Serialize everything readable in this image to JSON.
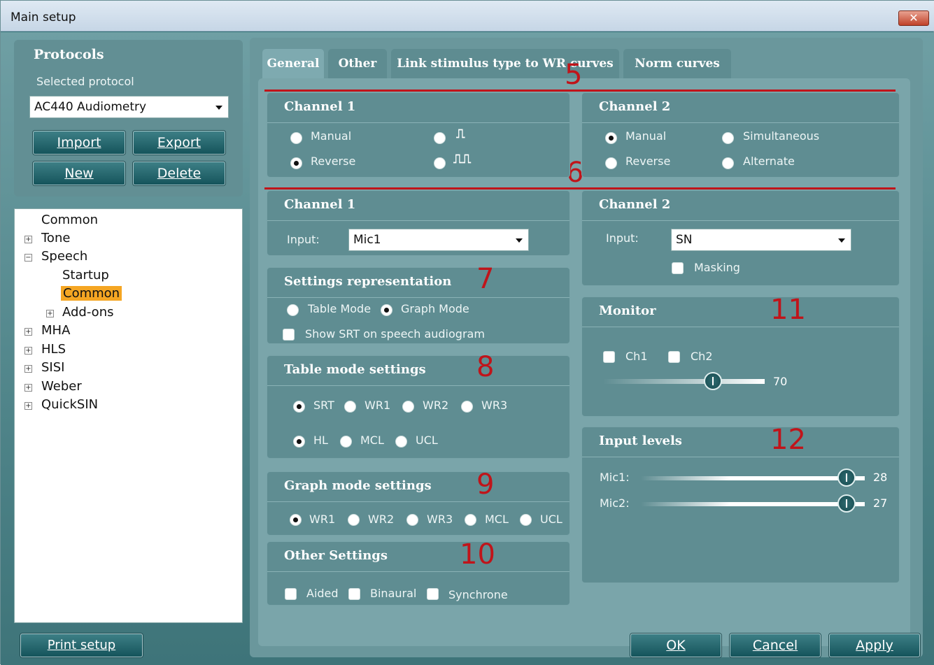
{
  "window": {
    "title": "Main setup",
    "close_glyph": "✕"
  },
  "protocols": {
    "heading": "Protocols",
    "selected_label": "Selected protocol",
    "selected_value": "AC440 Audiometry",
    "buttons": {
      "import": "Import",
      "export": "Export",
      "new": "New",
      "delete": "Delete"
    }
  },
  "tree": {
    "items": [
      {
        "label": "Common"
      },
      {
        "label": "Tone"
      },
      {
        "label": "Speech"
      },
      {
        "label": "Startup"
      },
      {
        "label": "Common"
      },
      {
        "label": "Add-ons"
      },
      {
        "label": "MHA"
      },
      {
        "label": "HLS"
      },
      {
        "label": "SISI"
      },
      {
        "label": "Weber"
      },
      {
        "label": "QuickSIN"
      }
    ]
  },
  "tabs": [
    {
      "label": "General"
    },
    {
      "label": "Other"
    },
    {
      "label": "Link stimulus type to WR curves"
    },
    {
      "label": "Norm curves"
    }
  ],
  "annotations": {
    "n5": "5",
    "n6": "6",
    "n7": "7",
    "n8": "8",
    "n9": "9",
    "n10": "10",
    "n11": "11",
    "n12": "12"
  },
  "stim1": {
    "title": "Channel 1",
    "manual": "Manual",
    "reverse": "Reverse",
    "pulse_single": "⎍",
    "pulse_multi": "⎍⎍"
  },
  "stim2": {
    "title": "Channel 2",
    "manual": "Manual",
    "reverse": "Reverse",
    "simultaneous": "Simultaneous",
    "alternate": "Alternate"
  },
  "input1": {
    "title": "Channel 1",
    "input_label": "Input:",
    "input_value": "Mic1"
  },
  "input2": {
    "title": "Channel 2",
    "input_label": "Input:",
    "input_value": "SN",
    "masking": "Masking"
  },
  "settings_rep": {
    "title": "Settings representation",
    "table_mode": "Table Mode",
    "graph_mode": "Graph Mode",
    "show_srt": "Show SRT on speech audiogram"
  },
  "table_mode": {
    "title": "Table mode settings",
    "srt": "SRT",
    "wr1": "WR1",
    "wr2": "WR2",
    "wr3": "WR3",
    "hl": "HL",
    "mcl": "MCL",
    "ucl": "UCL"
  },
  "graph_mode": {
    "title": "Graph mode settings",
    "wr1": "WR1",
    "wr2": "WR2",
    "wr3": "WR3",
    "mcl": "MCL",
    "ucl": "UCL"
  },
  "other_settings": {
    "title": "Other Settings",
    "aided": "Aided",
    "binaural": "Binaural",
    "synchrone": "Synchrone"
  },
  "monitor": {
    "title": "Monitor",
    "ch1": "Ch1",
    "ch2": "Ch2",
    "level_value": "70",
    "level_fraction": 0.68
  },
  "input_levels": {
    "title": "Input levels",
    "mic1_label": "Mic1:",
    "mic1_value": "28",
    "mic1_fraction": 0.92,
    "mic2_label": "Mic2:",
    "mic2_value": "27",
    "mic2_fraction": 0.92
  },
  "footer": {
    "print_setup": "Print setup",
    "ok": "OK",
    "cancel": "Cancel",
    "apply": "Apply"
  }
}
